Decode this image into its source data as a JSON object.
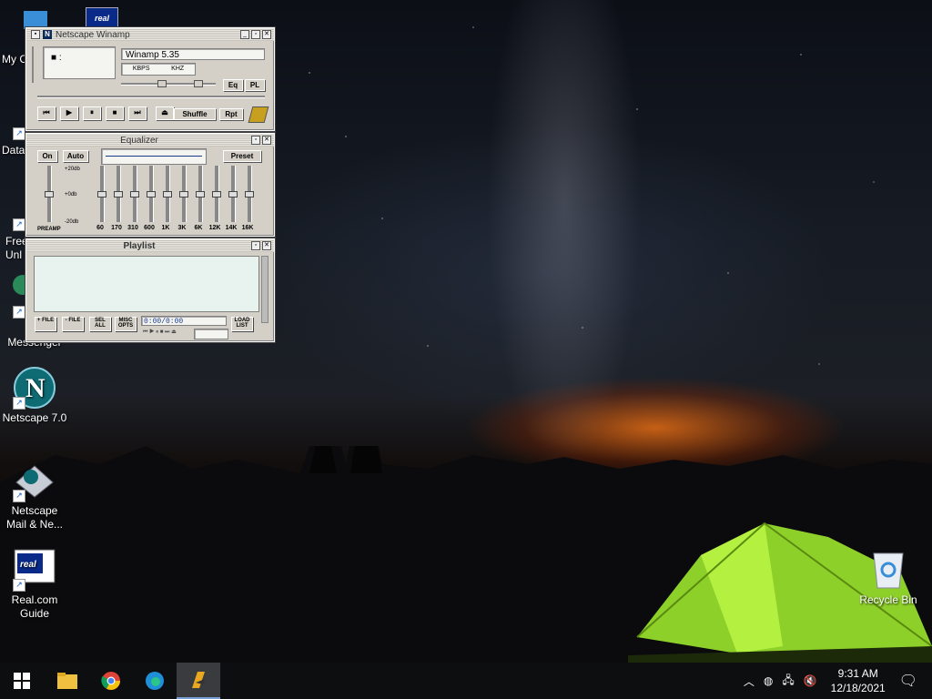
{
  "desktop_icons": [
    {
      "label": "My C",
      "icon": "my-computer-icon"
    },
    {
      "label": "Data",
      "icon": "data-icon"
    },
    {
      "label": "Free\nUnl",
      "icon": "free-unlimited-icon"
    },
    {
      "label": "In\nMessenger",
      "icon": "messenger-icon"
    },
    {
      "label": "Netscape 7.0",
      "icon": "netscape-icon"
    },
    {
      "label": "Netscape\nMail & Ne...",
      "icon": "netscape-mail-icon"
    },
    {
      "label": "Real.com\nGuide",
      "icon": "real-guide-icon"
    },
    {
      "label": "Recycle Bin",
      "icon": "recycle-bin-icon"
    }
  ],
  "real_tile": "real",
  "winamp": {
    "main": {
      "title": "Netscape Winamp",
      "time_display": "■ :",
      "song_title": "Winamp 5.35",
      "kbps": "KBPS",
      "khz": "KHZ",
      "eq_button": "Eq",
      "pl_button": "PL",
      "shuffle": "Shuffle",
      "repeat": "Rpt"
    },
    "equalizer": {
      "title": "Equalizer",
      "on": "On",
      "auto": "Auto",
      "preset": "Preset",
      "db_top": "+20db",
      "db_mid": "+0db",
      "db_bottom": "-20db",
      "preamp": "PREAMP",
      "bands": [
        "60",
        "170",
        "310",
        "600",
        "1K",
        "3K",
        "6K",
        "12K",
        "14K",
        "16K"
      ]
    },
    "playlist": {
      "title": "Playlist",
      "add_file": "+ FILE",
      "remove_file": "- FILE",
      "sel_all": "SEL ALL",
      "misc_opts": "MISC OPTS",
      "time": "0:00/0:00",
      "load_list": "LOAD LIST"
    }
  },
  "taskbar": {
    "apps": [
      "start",
      "file-explorer",
      "chrome",
      "edge",
      "winamp"
    ],
    "time": "9:31 AM",
    "date": "12/18/2021"
  },
  "colors": {
    "taskbar": "#0d0e10",
    "winamp_face": "#d4d0c8",
    "tent": "#9ee02a"
  }
}
